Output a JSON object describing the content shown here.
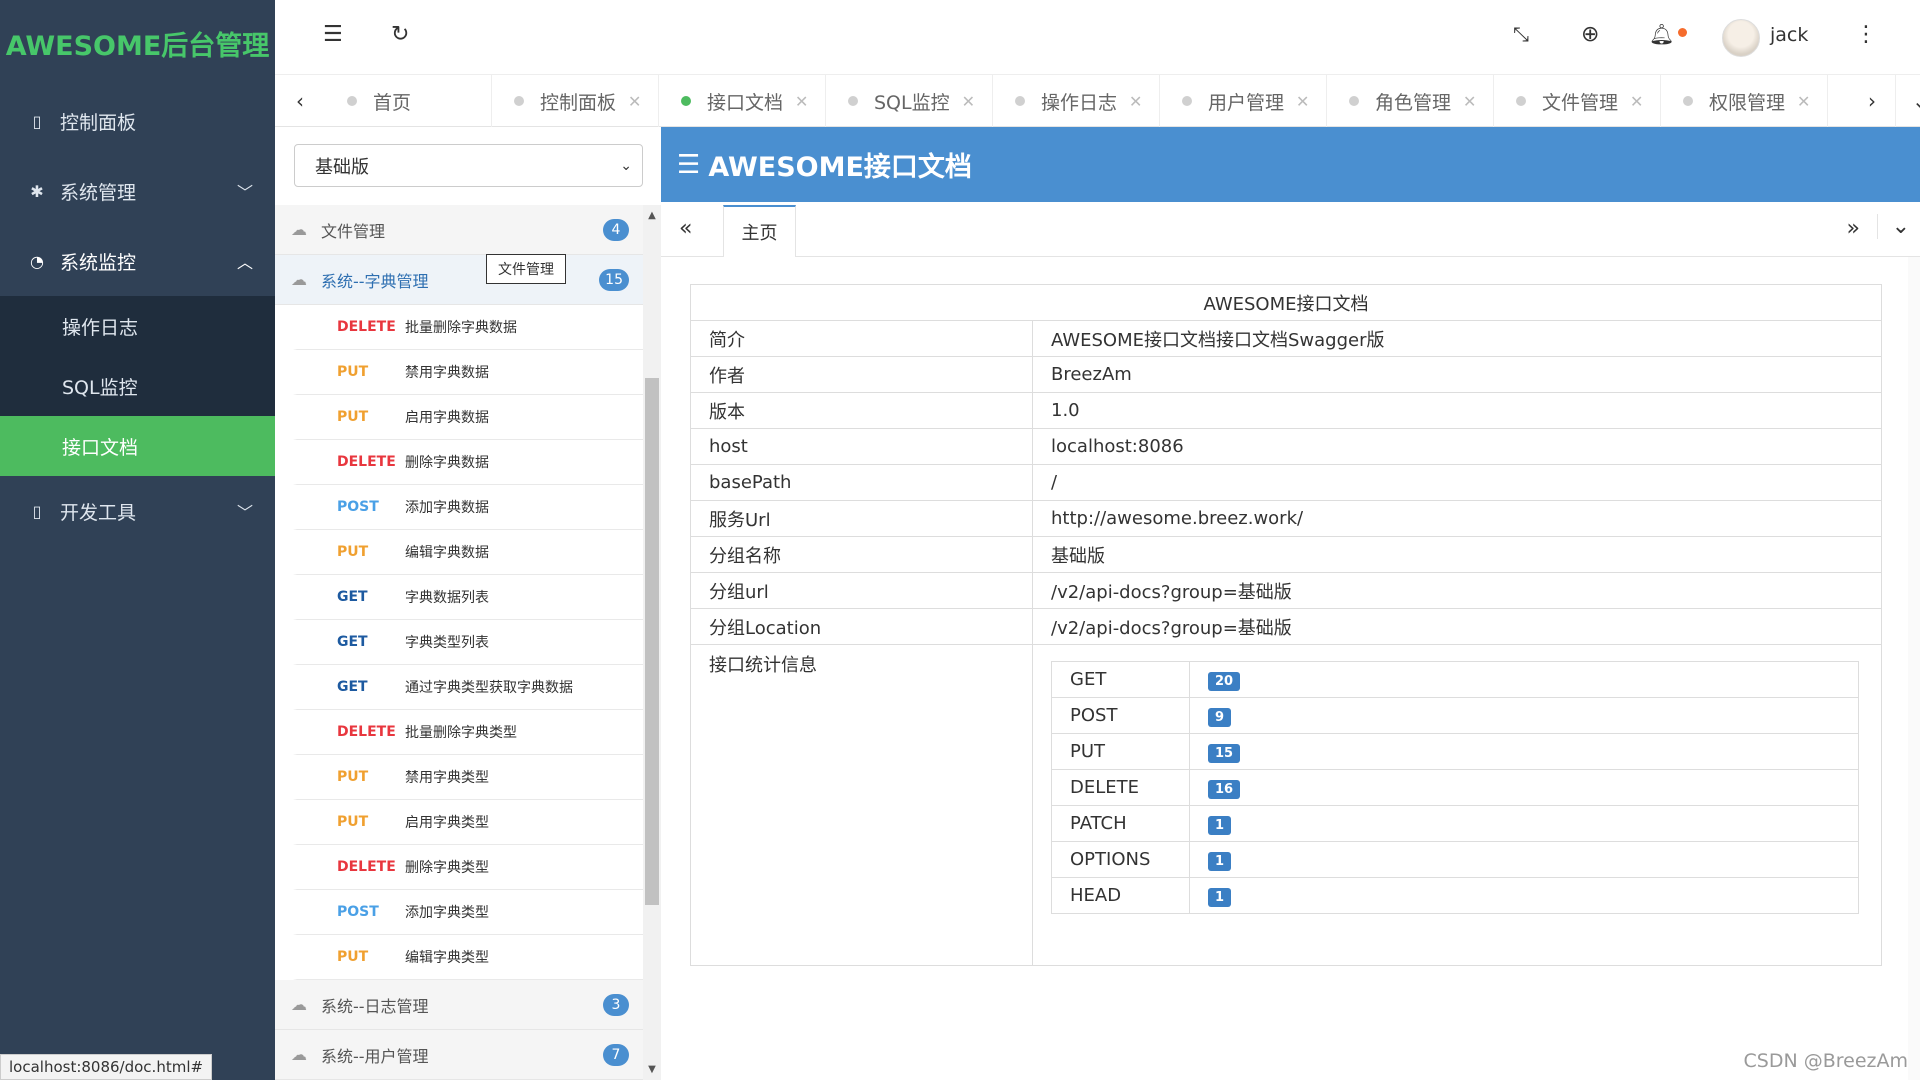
{
  "app": {
    "logo": "AWESOME后台管理"
  },
  "sidebar": {
    "items": [
      {
        "label": "控制面板",
        "icon": "square-icon"
      },
      {
        "label": "系统管理",
        "icon": "gear-icon"
      },
      {
        "label": "系统监控",
        "icon": "dashboard-icon"
      },
      {
        "label": "开发工具",
        "icon": "square-icon"
      }
    ],
    "sub": [
      {
        "label": "操作日志"
      },
      {
        "label": "SQL监控"
      },
      {
        "label": "接口文档"
      }
    ]
  },
  "header": {
    "user": "jack"
  },
  "tabs": [
    {
      "label": "首页"
    },
    {
      "label": "控制面板"
    },
    {
      "label": "接口文档"
    },
    {
      "label": "SQL监控"
    },
    {
      "label": "操作日志"
    },
    {
      "label": "用户管理"
    },
    {
      "label": "角色管理"
    },
    {
      "label": "文件管理"
    },
    {
      "label": "权限管理"
    }
  ],
  "group_select": {
    "value": "基础版"
  },
  "apilist": {
    "groups": [
      {
        "name": "文件管理",
        "count": "4"
      },
      {
        "name": "系统--字典管理",
        "count": "15"
      },
      {
        "name": "系统--日志管理",
        "count": "3"
      },
      {
        "name": "系统--用户管理",
        "count": "7"
      }
    ],
    "tooltip": "文件管理",
    "apis": [
      {
        "method": "DELETE",
        "name": "批量删除字典数据"
      },
      {
        "method": "PUT",
        "name": "禁用字典数据"
      },
      {
        "method": "PUT",
        "name": "启用字典数据"
      },
      {
        "method": "DELETE",
        "name": "删除字典数据"
      },
      {
        "method": "POST",
        "name": "添加字典数据"
      },
      {
        "method": "PUT",
        "name": "编辑字典数据"
      },
      {
        "method": "GET",
        "name": "字典数据列表"
      },
      {
        "method": "GET",
        "name": "字典类型列表"
      },
      {
        "method": "GET",
        "name": "通过字典类型获取字典数据"
      },
      {
        "method": "DELETE",
        "name": "批量删除字典类型"
      },
      {
        "method": "PUT",
        "name": "禁用字典类型"
      },
      {
        "method": "PUT",
        "name": "启用字典类型"
      },
      {
        "method": "DELETE",
        "name": "删除字典类型"
      },
      {
        "method": "POST",
        "name": "添加字典类型"
      },
      {
        "method": "PUT",
        "name": "编辑字典类型"
      }
    ]
  },
  "doc": {
    "header": "AWESOME接口文档",
    "home_tab": "主页",
    "table_title": "AWESOME接口文档",
    "rows": [
      {
        "k": "简介",
        "v": "AWESOME接口文档接口文档Swagger版"
      },
      {
        "k": "作者",
        "v": "BreezAm"
      },
      {
        "k": "版本",
        "v": "1.0"
      },
      {
        "k": "host",
        "v": "localhost:8086"
      },
      {
        "k": "basePath",
        "v": "/"
      },
      {
        "k": "服务Url",
        "v": "http://awesome.breez.work/"
      },
      {
        "k": "分组名称",
        "v": "基础版"
      },
      {
        "k": "分组url",
        "v": "/v2/api-docs?group=基础版"
      },
      {
        "k": "分组Location",
        "v": "/v2/api-docs?group=基础版"
      }
    ],
    "stats_label": "接口统计信息",
    "stats": [
      {
        "method": "GET",
        "count": "20"
      },
      {
        "method": "POST",
        "count": "9"
      },
      {
        "method": "PUT",
        "count": "15"
      },
      {
        "method": "DELETE",
        "count": "16"
      },
      {
        "method": "PATCH",
        "count": "1"
      },
      {
        "method": "OPTIONS",
        "count": "1"
      },
      {
        "method": "HEAD",
        "count": "1"
      }
    ]
  },
  "statusbar": "localhost:8086/doc.html#",
  "watermark": "CSDN @BreezAm"
}
